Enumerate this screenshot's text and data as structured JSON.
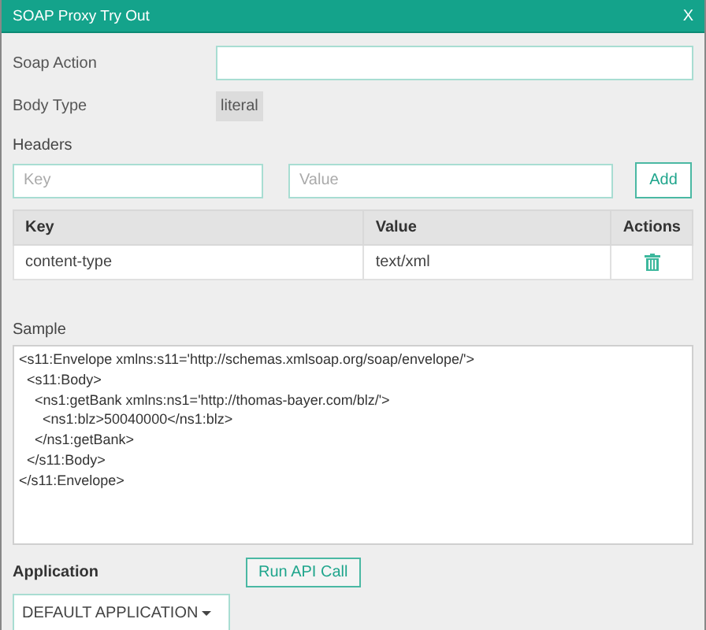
{
  "window": {
    "title": "SOAP Proxy Try Out",
    "close": "X"
  },
  "soap_action": {
    "label": "Soap Action"
  },
  "body_type": {
    "label": "Body Type",
    "value": "literal"
  },
  "headers": {
    "label": "Headers",
    "key_placeholder": "Key",
    "value_placeholder": "Value",
    "add_button": "Add"
  },
  "table": {
    "columns": [
      "Key",
      "Value",
      "Actions"
    ],
    "rows": [
      {
        "key": "content-type",
        "value": "text/xml"
      }
    ]
  },
  "sample": {
    "label": "Sample",
    "value": "<s11:Envelope xmlns:s11='http://schemas.xmlsoap.org/soap/envelope/'>\n  <s11:Body>\n    <ns1:getBank xmlns:ns1='http://thomas-bayer.com/blz/'>\n      <ns1:blz>50040000</ns1:blz>\n    </ns1:getBank>\n  </s11:Body>\n</s11:Envelope>"
  },
  "application": {
    "label": "Application",
    "run_button": "Run API Call",
    "selected": "DEFAULT APPLICATION"
  }
}
